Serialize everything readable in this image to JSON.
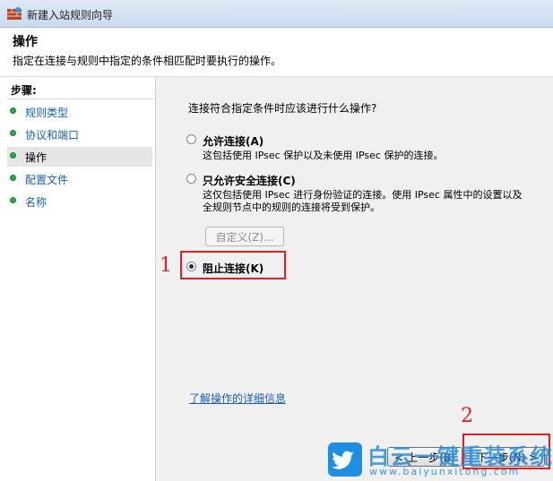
{
  "window": {
    "title": "新建入站规则向导"
  },
  "header": {
    "title": "操作",
    "description": "指定在连接与规则中指定的条件相匹配时要执行的操作。"
  },
  "sidebar": {
    "heading": "步骤:",
    "items": [
      {
        "label": "规则类型",
        "active": false
      },
      {
        "label": "协议和端口",
        "active": false
      },
      {
        "label": "操作",
        "active": true
      },
      {
        "label": "配置文件",
        "active": false
      },
      {
        "label": "名称",
        "active": false
      }
    ]
  },
  "content": {
    "question": "连接符合指定条件时应该进行什么操作?",
    "options": [
      {
        "label": "允许连接(A)",
        "description": [
          "这包括使用 IPsec 保护以及未使用 IPsec 保护的连接。"
        ],
        "selected": false
      },
      {
        "label": "只允许安全连接(C)",
        "description": [
          "这仅包括使用 IPsec 进行身份验证的连接。使用 IPsec 属性中的设置以及",
          "全规则节点中的规则的连接将受到保护。"
        ],
        "selected": false
      },
      {
        "label": "阻止连接(K)",
        "description": [],
        "selected": true
      }
    ],
    "custom_button": "自定义(Z)...",
    "learn_more": "了解操作的详细信息"
  },
  "footer": {
    "back_button": "< 上一步(B)",
    "next_button": "下一步(N) >"
  },
  "annotations": {
    "mark1": "1",
    "mark2": "2",
    "accent": "#e02020"
  },
  "watermark": {
    "brand": "白云一键重装系统",
    "url": "www.baiyunxitong.com"
  }
}
